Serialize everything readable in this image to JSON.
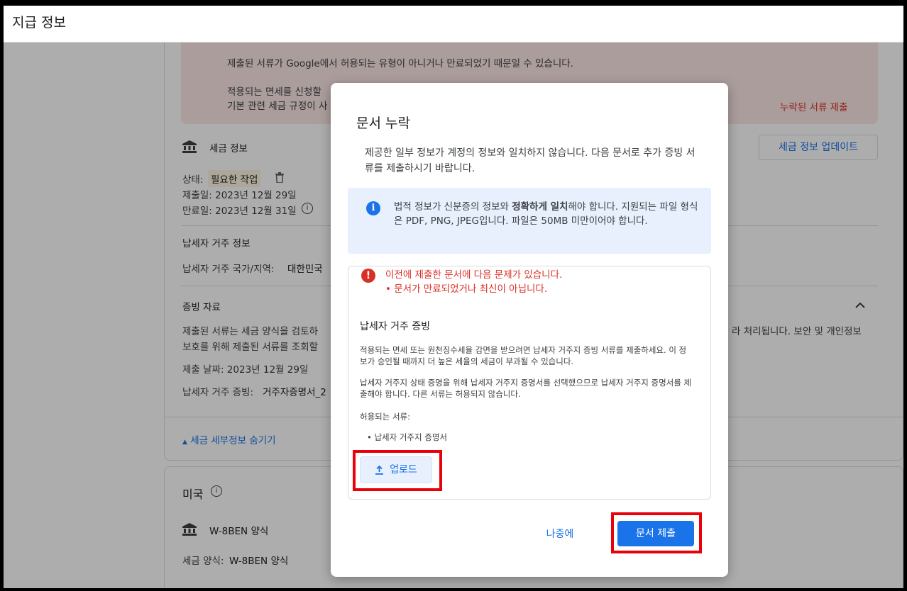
{
  "page": {
    "title": "지급 정보"
  },
  "background": {
    "alert_line1": "제출된 서류가 Google에서 허용되는 유형이 아니거나 만료되었기 때문일 수 있습니다.",
    "alert_line2": "적용되는 면세를 신청할",
    "alert_line3": "기본 관련 세금 규정이 사",
    "alert_action": "누락된 서류 제출",
    "tax_info_title": "세금 정보",
    "tax_info_update_button": "세금 정보 업데이트",
    "status_label": "상태:",
    "status_value": "필요한 작업",
    "submit_date": "제출일: 2023년 12월 29일",
    "expire_date": "만료일: 2023년 12월 31일",
    "residency_title": "납세자 거주 정보",
    "residency_country": "납세자 거주 국가/지역:",
    "residency_country_value": "대한민국",
    "evidence_title": "증빙 자료",
    "evidence_desc1_left": "제출된 서류는 세금 양식을 검토하",
    "evidence_desc1_right": "라 처리됩니다. 보안 및 개인정보",
    "evidence_desc2": "보호를 위해 제출된 서류를 조회할",
    "evidence_date": "제출 날짜: 2023년 12월 29일",
    "evidence_doc_label": "납세자 거주 증빙:",
    "evidence_doc_value": "거주자증명서_2",
    "hide_details": "세금 세부정보 숨기기",
    "us_title": "미국",
    "w8ben_title": "W-8BEN 양식",
    "tax_form_label": "세금 양식:",
    "tax_form_value": "W-8BEN 양식"
  },
  "dialog": {
    "title": "문서 누락",
    "description": "제공한 일부 정보가 계정의 정보와 일치하지 않습니다. 다음 문서로 추가 증빙 서류를 제출하시기 바랍니다.",
    "info_pre": "법적 정보가 신분증의 정보와 ",
    "info_bold": "정확하게 일치",
    "info_post": "해야 합니다. 지원되는 파일 형식은 PDF, PNG, JPEG입니다. 파일은 50MB 미만이어야 합니다.",
    "error_line1": "이전에 제출한 문서에 다음 문제가 있습니다.",
    "error_line2": "• 문서가 만료되었거나 최신이 아닙니다.",
    "section_title": "납세자 거주 증빙",
    "para1": "적용되는 면세 또는 원천징수세율 감면을 받으려면 납세자 거주지 증빙 서류를 제출하세요. 이 정보가 승인될 때까지 더 높은 세율의 세금이 부과될 수 있습니다.",
    "para2": "납세자 거주지 상태 증명을 위해 납세자 거주지 증명서를 선택했으므로 납세자 거주지 증명서를 제출해야 합니다. 다른 서류는 허용되지 않습니다.",
    "allowed_label": "허용되는 서류:",
    "allowed_item": "납세자 거주지 증명서",
    "upload_button": "업로드",
    "later_button": "나중에",
    "submit_button": "문서 제출"
  },
  "icons": {
    "info": "info-icon",
    "error": "error-icon",
    "upload": "upload-icon",
    "bank": "bank-icon",
    "trash": "trash-icon",
    "chevron": "chevron-up-icon"
  },
  "colors": {
    "accent": "#1a73e8",
    "error": "#d93025",
    "highlight": "#e8000b"
  }
}
